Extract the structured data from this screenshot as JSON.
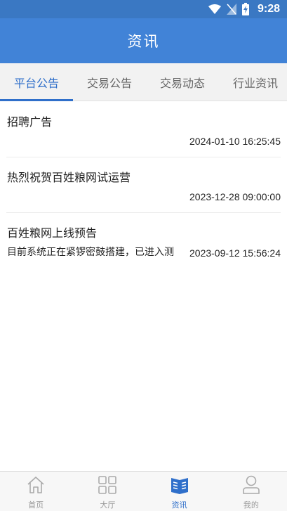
{
  "status_bar": {
    "time": "9:28"
  },
  "header": {
    "title": "资讯"
  },
  "tabs": [
    {
      "label": "平台公告",
      "active": true
    },
    {
      "label": "交易公告",
      "active": false
    },
    {
      "label": "交易动态",
      "active": false
    },
    {
      "label": "行业资讯",
      "active": false
    }
  ],
  "news": [
    {
      "title": "招聘广告",
      "summary": "",
      "date": "2024-01-10 16:25:45"
    },
    {
      "title": "热烈祝贺百姓粮网试运营",
      "summary": "",
      "date": "2023-12-28 09:00:00"
    },
    {
      "title": "百姓粮网上线预告",
      "summary": "目前系统正在紧锣密鼓搭建，已进入测",
      "date": "2023-09-12 15:56:24"
    }
  ],
  "bottom_nav": [
    {
      "label": "首页",
      "icon": "home-icon",
      "active": false
    },
    {
      "label": "大厅",
      "icon": "grid-icon",
      "active": false
    },
    {
      "label": "资讯",
      "icon": "news-icon",
      "active": true
    },
    {
      "label": "我的",
      "icon": "user-icon",
      "active": false
    }
  ],
  "colors": {
    "primary": "#4183d7",
    "status_bar": "#3a78c3",
    "tab_active": "#2f6fca",
    "inactive": "#999999"
  }
}
